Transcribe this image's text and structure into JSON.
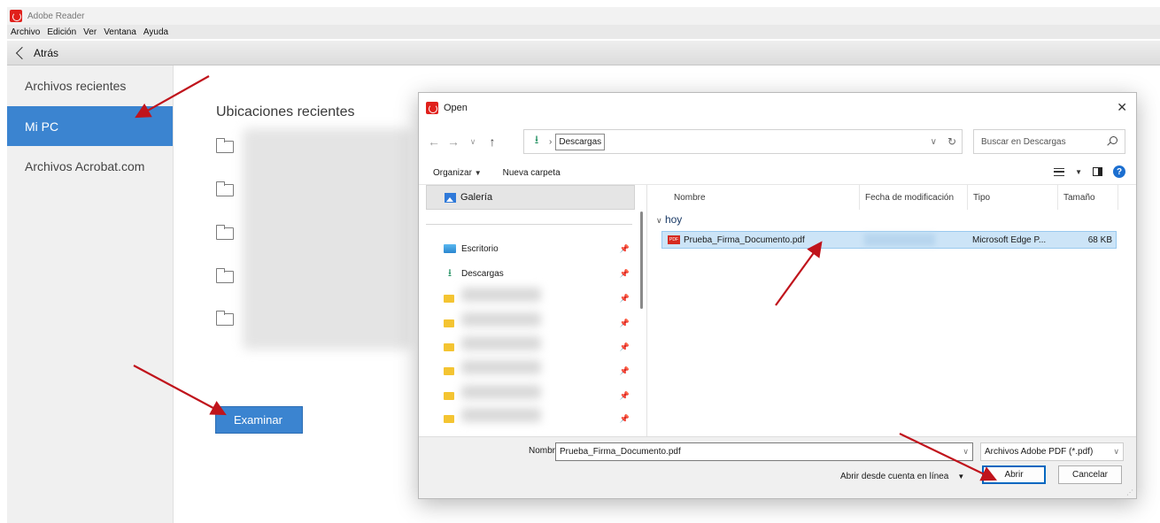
{
  "window": {
    "title": "Adobe Reader"
  },
  "menu": [
    "Archivo",
    "Edición",
    "Ver",
    "Ventana",
    "Ayuda"
  ],
  "toolbar": {
    "back_label": "Atrás"
  },
  "sidebar": {
    "items": [
      {
        "label": "Archivos recientes",
        "active": false
      },
      {
        "label": "Mi PC",
        "active": true
      },
      {
        "label": "Archivos Acrobat.com",
        "active": false
      }
    ]
  },
  "main": {
    "heading": "Ubicaciones recientes",
    "browse_label": "Examinar"
  },
  "dialog": {
    "title": "Open",
    "address": {
      "crumb": "Descargas"
    },
    "search_placeholder": "Buscar en Descargas",
    "commands": {
      "organize": "Organizar",
      "new_folder": "Nueva carpeta"
    },
    "nav": {
      "gallery": "Galería",
      "desktop": "Escritorio",
      "downloads": "Descargas"
    },
    "columns": {
      "name": "Nombre",
      "modified": "Fecha de modificación",
      "type": "Tipo",
      "size": "Tamaño"
    },
    "group": "hoy",
    "file": {
      "name": "Prueba_Firma_Documento.pdf",
      "type": "Microsoft Edge P...",
      "size": "68 KB"
    },
    "footer": {
      "name_label": "Nombre:",
      "name_value": "Prueba_Firma_Documento.pdf",
      "filter": "Archivos Adobe PDF (*.pdf)",
      "online": "Abrir desde cuenta en línea",
      "open": "Abrir",
      "cancel": "Cancelar"
    }
  },
  "colors": {
    "accent": "#3b84d0",
    "annotation": "#c0141c",
    "pdf_red": "#e0201b"
  }
}
